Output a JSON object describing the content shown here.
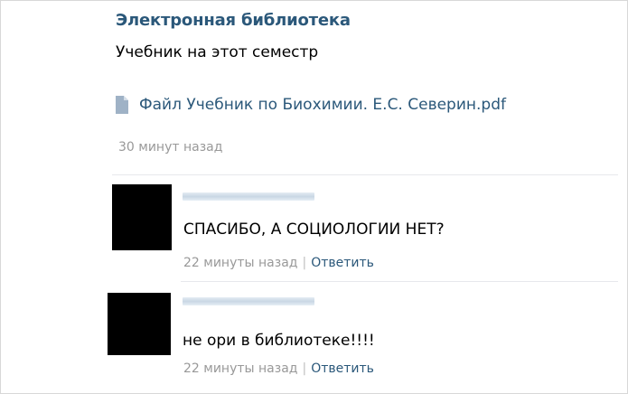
{
  "post": {
    "author": "Электронная библиотека",
    "text": "Учебник на этот семестр",
    "attachment": {
      "icon": "document-icon",
      "file_name": "Файл Учебник по Биохимии. Е.С. Северин.pdf"
    },
    "time": "30 минут назад"
  },
  "comments": [
    {
      "text": "СПАСИБО, А СОЦИОЛОГИИ НЕТ?",
      "time": "22 минуты назад",
      "separator": "|",
      "reply_label": "Ответить"
    },
    {
      "text": "не ори в библиотеке!!!!",
      "time": "22 минуты назад",
      "separator": "|",
      "reply_label": "Ответить"
    }
  ],
  "colors": {
    "link": "#2b587a",
    "muted": "#999999",
    "divider": "#e7e8ec"
  }
}
